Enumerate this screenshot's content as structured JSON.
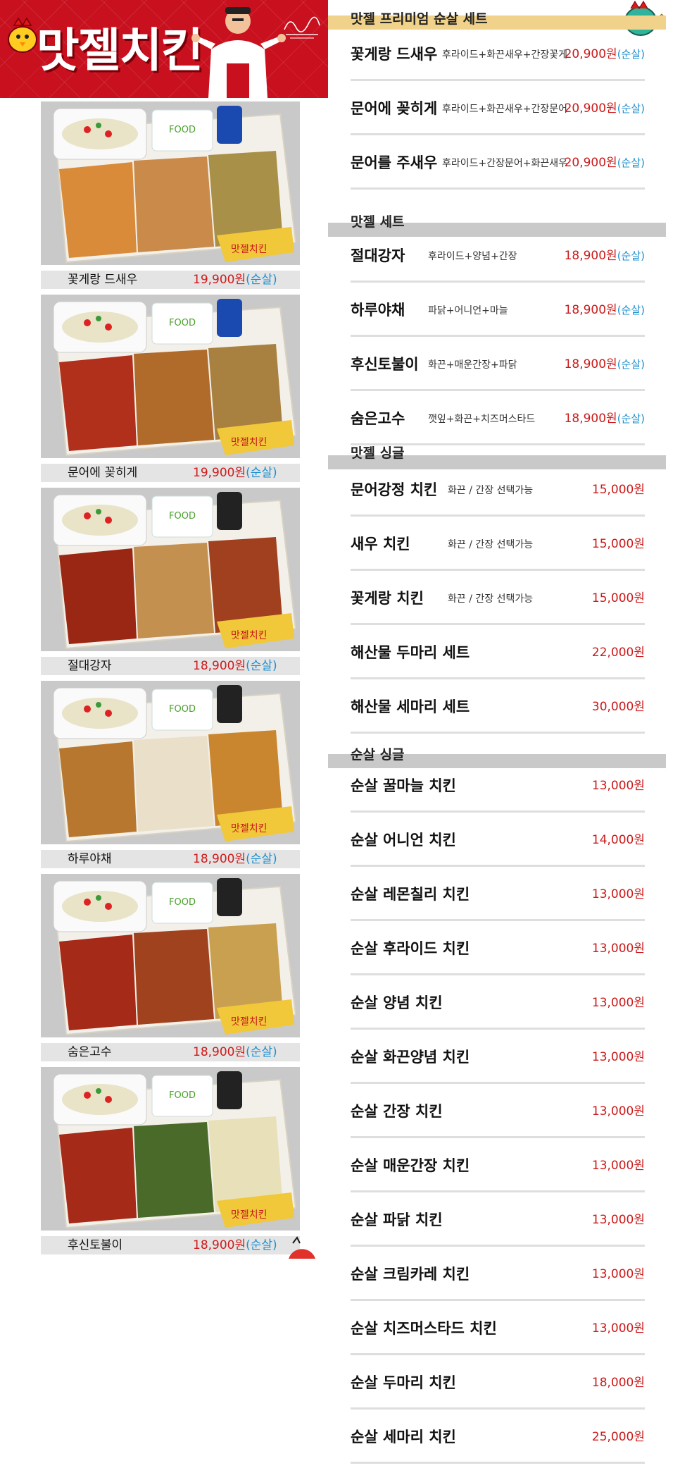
{
  "banner": {
    "logo_text": "맛젤치킨",
    "brand_color": "#c8101e"
  },
  "photos": [
    {
      "name": "꽃게랑 드새우",
      "price": "19,900원",
      "tag": "(순살)"
    },
    {
      "name": "문어에 꽂히게",
      "price": "19,900원",
      "tag": "(순살)"
    },
    {
      "name": "절대강자",
      "price": "18,900원",
      "tag": "(순살)"
    },
    {
      "name": "하루야채",
      "price": "18,900원",
      "tag": "(순살)"
    },
    {
      "name": "숨은고수",
      "price": "18,900원",
      "tag": "(순살)"
    },
    {
      "name": "후신토불이",
      "price": "18,900원",
      "tag": "(순살)"
    }
  ],
  "menu": {
    "sections": [
      {
        "title": "맛젤 프리미엄 순살 세트",
        "items": [
          {
            "name": "꽃게랑 드새우",
            "desc": "후라이드+화끈새우+간장꽃게",
            "price": "20,900원",
            "tag": "(순살)"
          },
          {
            "name": "문어에 꽂히게",
            "desc": "후라이드+화끈새우+간장문어",
            "price": "20,900원",
            "tag": "(순살)"
          },
          {
            "name": "문어를 주새우",
            "desc": "후라이드+간장문어+화끈새우",
            "price": "20,900원",
            "tag": "(순살)"
          }
        ]
      },
      {
        "title": "맛젤 세트",
        "items": [
          {
            "name": "절대강자",
            "desc": "후라이드+양념+간장",
            "price": "18,900원",
            "tag": "(순살)"
          },
          {
            "name": "하루야채",
            "desc": "파닭+어니언+마늘",
            "price": "18,900원",
            "tag": "(순살)"
          },
          {
            "name": "후신토불이",
            "desc": "화끈+매운간장+파닭",
            "price": "18,900원",
            "tag": "(순살)"
          },
          {
            "name": "숨은고수",
            "desc": "깻잎+화끈+치즈머스타드",
            "price": "18,900원",
            "tag": "(순살)"
          }
        ]
      },
      {
        "title": "맛젤 싱글",
        "items": [
          {
            "name": "문어강정 치킨",
            "desc": "화끈 / 간장 선택가능",
            "price": "15,000원"
          },
          {
            "name": "새우 치킨",
            "desc": "화끈 / 간장 선택가능",
            "price": "15,000원"
          },
          {
            "name": "꽃게랑 치킨",
            "desc": "화끈 / 간장 선택가능",
            "price": "15,000원"
          },
          {
            "name": "해산물 두마리 세트",
            "price": "22,000원"
          },
          {
            "name": "해산물 세마리 세트",
            "price": "30,000원"
          }
        ]
      },
      {
        "title": "순살 싱글",
        "items": [
          {
            "name": "순살 꿀마늘 치킨",
            "price": "13,000원"
          },
          {
            "name": "순살 어니언 치킨",
            "price": "14,000원"
          },
          {
            "name": "순살 레몬칠리 치킨",
            "price": "13,000원"
          },
          {
            "name": "순살 후라이드 치킨",
            "price": "13,000원"
          },
          {
            "name": "순살 양념 치킨",
            "price": "13,000원"
          },
          {
            "name": "순살 화끈양념 치킨",
            "price": "13,000원"
          },
          {
            "name": "순살 간장 치킨",
            "price": "13,000원"
          },
          {
            "name": "순살 매운간장 치킨",
            "price": "13,000원"
          },
          {
            "name": "순살 파닭 치킨",
            "price": "13,000원"
          },
          {
            "name": "순살 크림카레 치킨",
            "price": "13,000원"
          },
          {
            "name": "순살 치즈머스타드 치킨",
            "price": "13,000원"
          },
          {
            "name": "순살 두마리 치킨",
            "price": "18,000원"
          },
          {
            "name": "순살 세마리 치킨",
            "price": "25,000원"
          }
        ]
      }
    ]
  },
  "colors": {
    "price_red": "#cc1a1a",
    "tag_blue": "#1b8fd0",
    "premium_bar": "#f1d28b",
    "section_bar": "#c9c9c9"
  }
}
